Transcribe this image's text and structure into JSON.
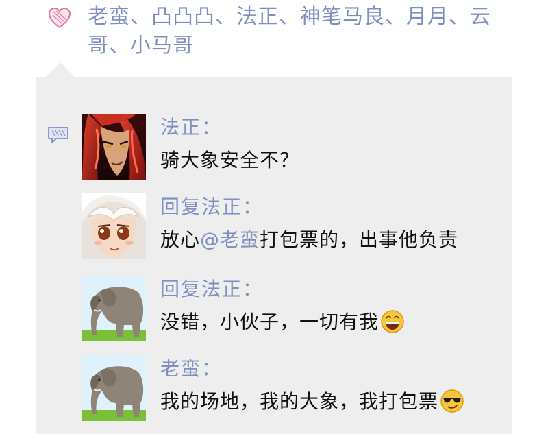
{
  "likes": {
    "icon": "heart-icon",
    "text": "老蛮、凸凸凸、法正、神笔马良、月月、云哥、小马哥"
  },
  "comments_icon": "comment-icon",
  "colors": {
    "link": "#7f8fc0",
    "panel_bg": "#eeeeee",
    "text": "#111111"
  },
  "comments": [
    {
      "avatar": "red-haired-warrior-avatar",
      "author": "法正：",
      "text": "骑大象安全不？"
    },
    {
      "avatar": "white-haired-girl-avatar",
      "author": "回复法正：",
      "text_before": "放心",
      "mention": "@老蛮",
      "text_after": "打包票的，出事他负责"
    },
    {
      "avatar": "elephant-avatar",
      "author": "回复法正：",
      "text": "没错，小伙子，一切有我",
      "emoji": "grinning-face-emoji"
    },
    {
      "avatar": "elephant-avatar",
      "author": "老蛮：",
      "text": "我的场地，我的大象，我打包票",
      "emoji": "sunglasses-face-emoji"
    }
  ]
}
